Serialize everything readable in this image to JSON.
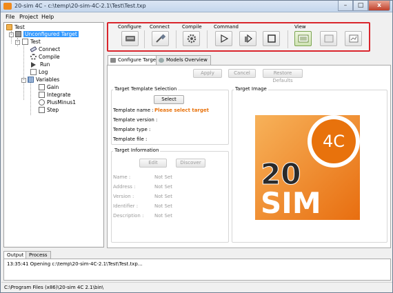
{
  "window": {
    "title": "20-sim 4C - c:\\temp\\20-sim-4C-2.1\\Test\\Test.txp",
    "controls": {
      "minimize": "–",
      "maximize": "□",
      "close": "x"
    }
  },
  "menu": [
    "File",
    "Project",
    "Help"
  ],
  "tree": {
    "root": "Test",
    "target": "Unconfigured Target",
    "model": "Test",
    "items": [
      "Connect",
      "Compile",
      "Run",
      "Log"
    ],
    "variables": "Variables",
    "variable_items": [
      "Gain",
      "Integrate",
      "PlusMinus1",
      "Step"
    ]
  },
  "toolbar": {
    "groups": [
      "Configure",
      "Connect",
      "Compile",
      "Command",
      "View"
    ]
  },
  "tabs": [
    "Configure Target",
    "Models Overview"
  ],
  "actions": {
    "apply": "Apply",
    "cancel": "Cancel",
    "restore": "Restore Defaults"
  },
  "template_selection": {
    "title": "Target Template Selection",
    "select": "Select",
    "name_label": "Template name :",
    "name_value": "Please select target",
    "version_label": "Template version :",
    "type_label": "Template type :",
    "file_label": "Template file :"
  },
  "target_info": {
    "title": "Target Information",
    "edit": "Edit",
    "discover": "Discover",
    "rows": [
      {
        "label": "Name :",
        "value": "Not Set"
      },
      {
        "label": "Address :",
        "value": "Not Set"
      },
      {
        "label": "Version :",
        "value": "Not Set"
      },
      {
        "label": "Identifier :",
        "value": "Not Set"
      },
      {
        "label": "Description :",
        "value": "Not Set"
      }
    ]
  },
  "target_image": {
    "title": "Target Image",
    "logo_badge": "4C",
    "logo_top": "20",
    "logo_bottom": "SIM"
  },
  "bottom_tabs": [
    "Output",
    "Process"
  ],
  "output_line": "13:35:41   Opening c:\\temp\\20-sim-4C-2.1\\Test\\Test.txp...",
  "status": "C:\\Program Files (x86)\\20-sim 4C 2.1\\bin\\",
  "colors": {
    "accent_orange": "#e8720c",
    "highlight_red": "#d9242b",
    "selection_blue": "#3399ff"
  }
}
